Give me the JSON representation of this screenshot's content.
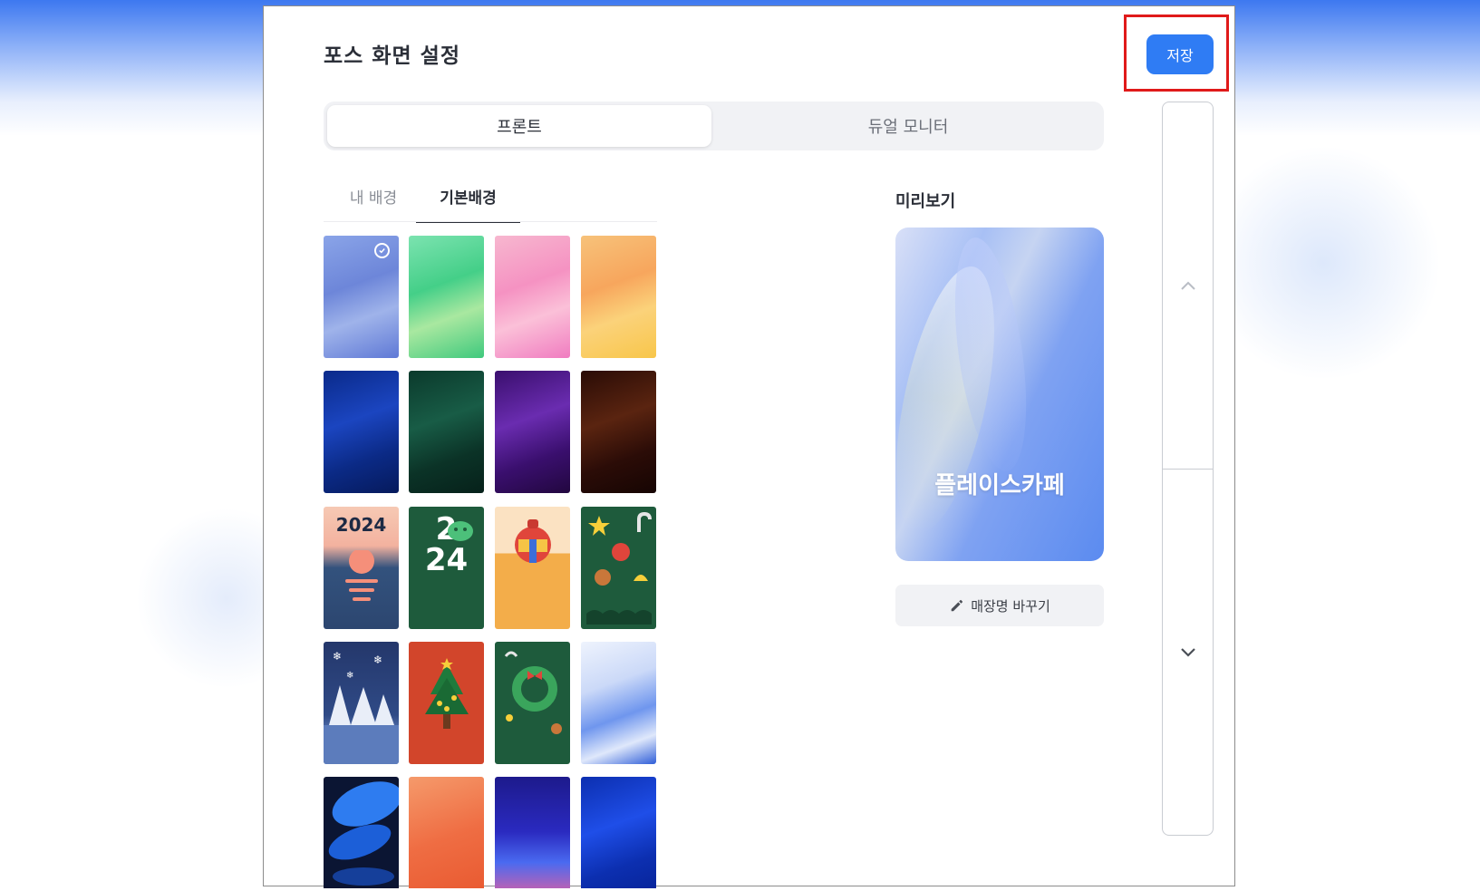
{
  "header": {
    "title": "포스 화면 설정",
    "save_label": "저장"
  },
  "segments": [
    {
      "label": "프론트",
      "active": true
    },
    {
      "label": "듀얼 모니터",
      "active": false
    }
  ],
  "tabs": [
    {
      "label": "내 배경",
      "active": false
    },
    {
      "label": "기본배경",
      "active": true
    }
  ],
  "thumbnails": {
    "selected_index": 0,
    "tile_2024_label": "2024",
    "tile_dragon_label_1": "2",
    "tile_dragon_label_2": "24"
  },
  "preview": {
    "title": "미리보기",
    "store_name": "플레이스카페",
    "rename_label": "매장명 바꾸기"
  },
  "colors": {
    "accent": "#2f7cf4",
    "highlight": "#e01a1a"
  }
}
